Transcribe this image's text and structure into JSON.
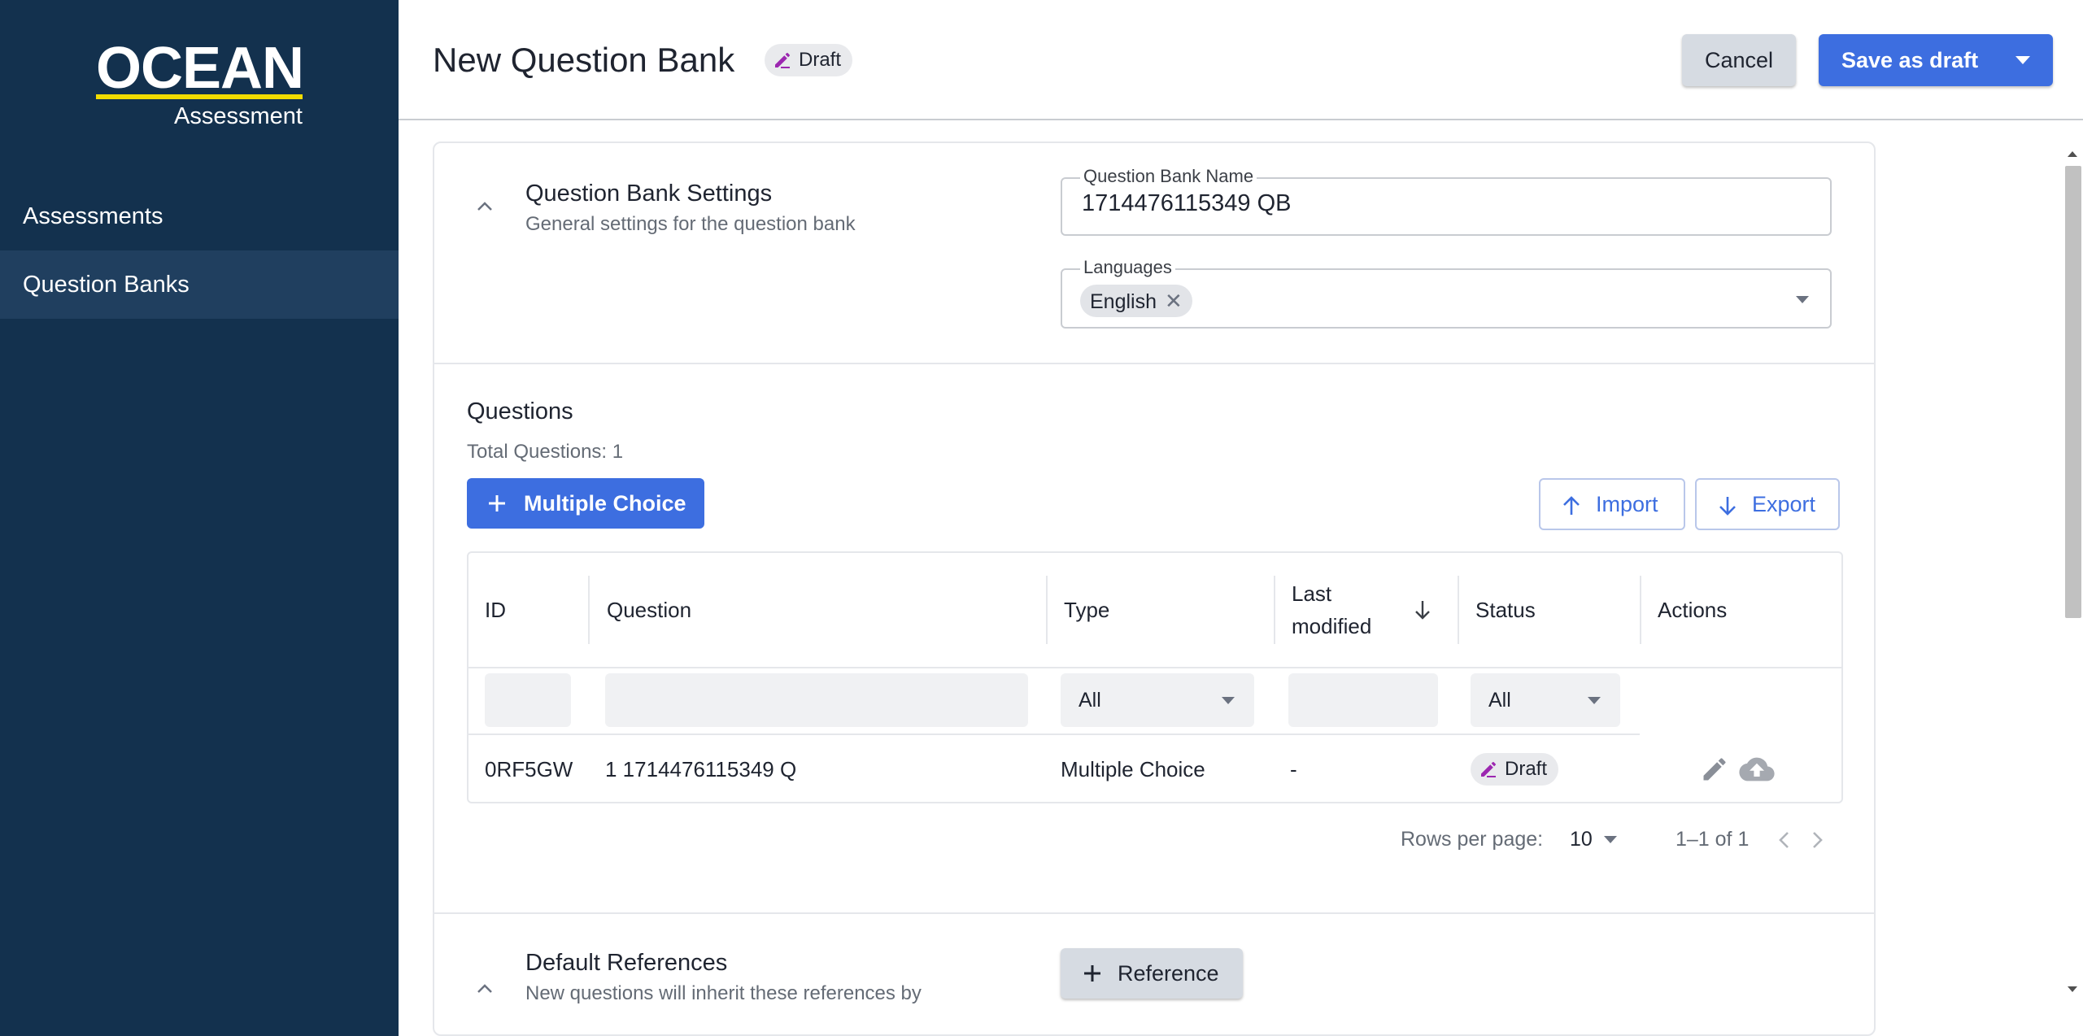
{
  "sidebar": {
    "logo_main": "OCEAN",
    "logo_sub": "Assessment",
    "items": [
      {
        "label": "Assessments",
        "active": false
      },
      {
        "label": "Question Banks",
        "active": true
      }
    ]
  },
  "header": {
    "title": "New Question Bank",
    "status_chip": "Draft",
    "cancel_label": "Cancel",
    "save_label": "Save as draft"
  },
  "settings": {
    "title": "Question Bank Settings",
    "subtitle": "General settings for the question bank",
    "name_label": "Question Bank Name",
    "name_value": "1714476115349 QB",
    "languages_label": "Languages",
    "languages": [
      "English"
    ]
  },
  "questions": {
    "title": "Questions",
    "total": "Total Questions: 1",
    "add_button": "Multiple Choice",
    "import_button": "Import",
    "export_button": "Export",
    "columns": {
      "id": "ID",
      "question": "Question",
      "type": "Type",
      "last_modified_line1": "Last",
      "last_modified_line2": "modified",
      "status": "Status",
      "actions": "Actions"
    },
    "filters": {
      "type": "All",
      "status": "All"
    },
    "rows": [
      {
        "id": "0RF5GW",
        "question": "1 1714476115349 Q",
        "type": "Multiple Choice",
        "last_modified": "-",
        "status": "Draft"
      }
    ],
    "pagination": {
      "rows_per_page_label": "Rows per page:",
      "rows_per_page": "10",
      "range": "1–1 of 1"
    }
  },
  "references": {
    "title": "Default References",
    "subtitle": "New questions will inherit these references by",
    "add_button": "Reference"
  },
  "colors": {
    "sidebar_bg": "#13314e",
    "sidebar_active": "#203f5f",
    "primary": "#3d6ee0",
    "logo_accent": "#f2dc00",
    "draft_icon": "#9c27b0"
  }
}
